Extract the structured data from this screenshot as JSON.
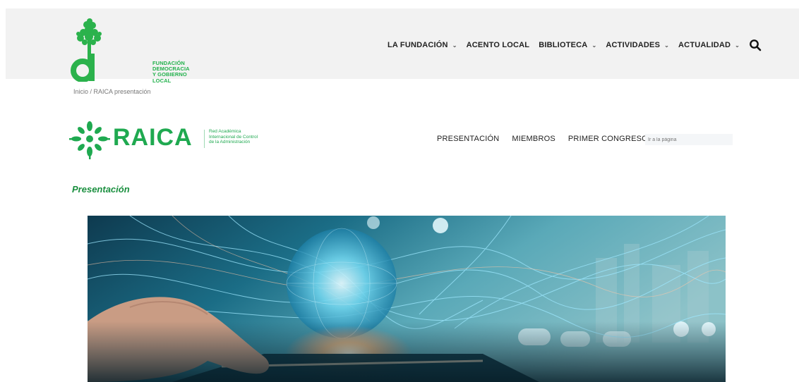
{
  "header": {
    "logo_lines": [
      "FUNDACIÓN",
      "DEMOCRACIA",
      "Y GOBIERNO LOCAL"
    ],
    "nav": [
      {
        "label": "LA FUNDACIÓN",
        "dropdown": true
      },
      {
        "label": "ACENTO LOCAL",
        "dropdown": false
      },
      {
        "label": "BIBLIOTECA",
        "dropdown": true
      },
      {
        "label": "ACTIVIDADES",
        "dropdown": true
      },
      {
        "label": "ACTUALIDAD",
        "dropdown": true
      }
    ],
    "search_icon": "search-icon"
  },
  "breadcrumb": "Inicio / RAICA presentación",
  "raica": {
    "name": "RAICA",
    "subtitle_lines": [
      "Red Académica",
      "Internacional de Control",
      "de la Administración"
    ],
    "nav": [
      {
        "label": "PRESENTACIÓN"
      },
      {
        "label": "MIEMBROS"
      },
      {
        "label": "PRIMER CONGRESO"
      }
    ],
    "input_placeholder": "Ir a la página"
  },
  "page_title": "Presentación",
  "colors": {
    "brand_green": "#1fa950",
    "title_green": "#1a8f3f",
    "header_bg": "#f2f2f2"
  }
}
